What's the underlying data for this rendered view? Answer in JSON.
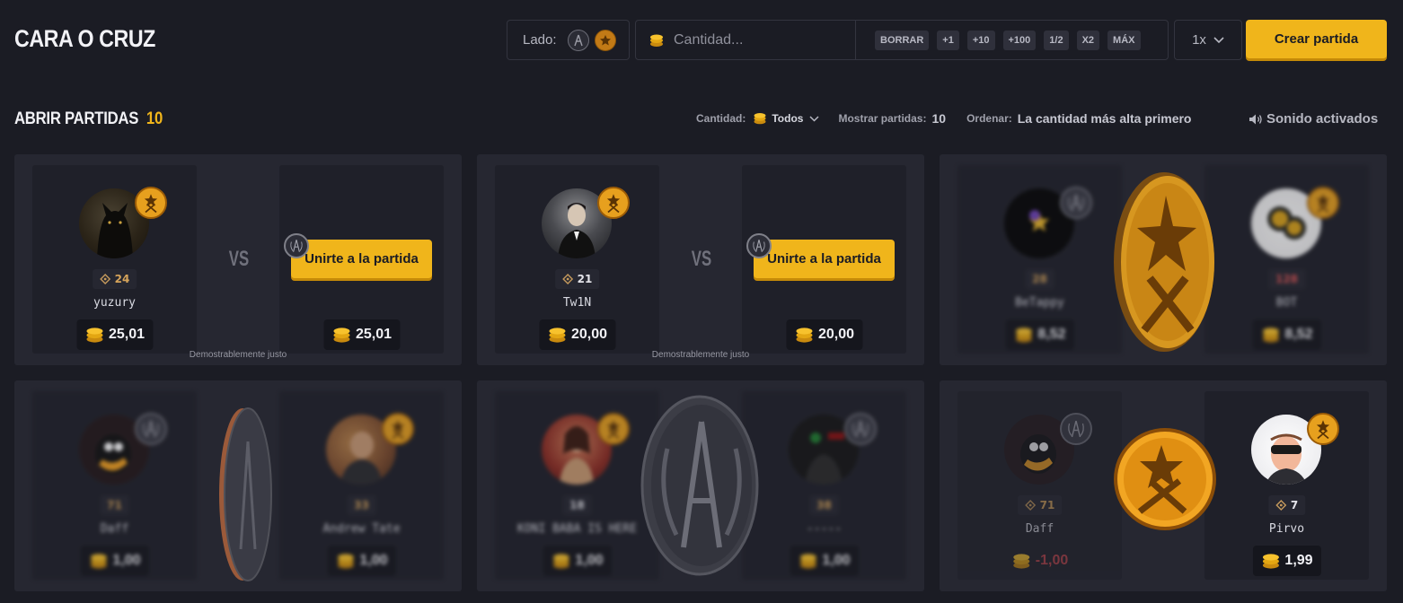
{
  "header": {
    "title": "CARA O CRUZ",
    "side_label": "Lado:",
    "amount_placeholder": "Cantidad...",
    "chips": [
      "BORRAR",
      "+1",
      "+10",
      "+100",
      "1/2",
      "X2",
      "MÁX"
    ],
    "multiplier": "1x",
    "create_button": "Crear partida"
  },
  "section": {
    "title": "ABRIR PARTIDAS",
    "count": "10"
  },
  "filters": {
    "amount_label": "Cantidad:",
    "amount_value": "Todos",
    "show_label": "Mostrar partidas:",
    "show_value": "10",
    "sort_label": "Ordenar:",
    "sort_value": "La cantidad más alta primero",
    "sound": "Sonido activados"
  },
  "games": [
    {
      "left": {
        "name": "yuzury",
        "level": "24",
        "amount": "25,01",
        "side": "t"
      },
      "right": {
        "amount": "25,01"
      },
      "vs": "VS",
      "join_label": "Unirte a la partida",
      "fair_label": "Demostrablemente justo"
    },
    {
      "left": {
        "name": "Tw1N",
        "level": "21",
        "amount": "20,00",
        "side": "t"
      },
      "right": {
        "amount": "20,00"
      },
      "vs": "VS",
      "join_label": "Unirte a la partida",
      "fair_label": "Demostrablemente justo"
    },
    {
      "left": {
        "name": "BeTappy",
        "level": "28",
        "amount": "8,52",
        "side": "ct"
      },
      "right": {
        "name": "BOT",
        "level": "128",
        "amount": "8,52",
        "side": "t"
      },
      "coin": "t"
    },
    {
      "left": {
        "name": "Daff",
        "level": "71",
        "amount": "1,00",
        "side": "ct"
      },
      "right": {
        "name": "Andrew Tate",
        "level": "33",
        "amount": "1,00",
        "side": "t"
      },
      "coin": "ct"
    },
    {
      "left": {
        "name": "KONI BABA IS HERE",
        "level": "18",
        "amount": "1,00",
        "side": "t"
      },
      "right": {
        "name": "-----",
        "level": "38",
        "amount": "1,00",
        "side": "ct"
      },
      "coin": "ct"
    },
    {
      "left": {
        "name": "Daff",
        "level": "71",
        "amount": "-1,00",
        "side": "ct"
      },
      "right": {
        "name": "Pirvo",
        "level": "7",
        "amount": "1,99",
        "side": "t"
      },
      "coin": "t"
    }
  ],
  "colors": {
    "accent": "#f0b51b",
    "background": "#1b1c24",
    "card": "#262731",
    "negative": "#c0444a"
  }
}
